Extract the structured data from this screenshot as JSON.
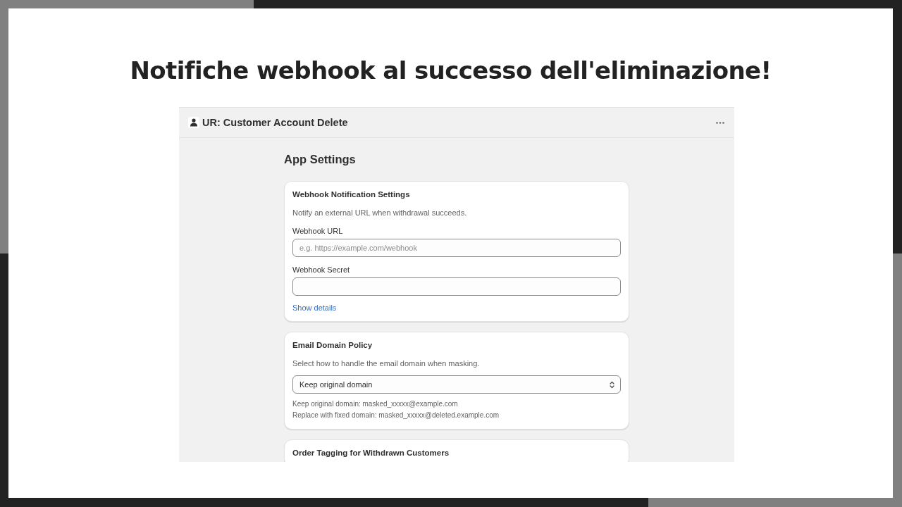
{
  "headline": "Notifiche webhook al successo dell'eliminazione!",
  "app": {
    "title": "UR: Customer Account Delete",
    "page_title": "App Settings",
    "cards": [
      {
        "title": "Webhook Notification Settings",
        "description": "Notify an external URL when withdrawal succeeds.",
        "fields": [
          {
            "kind": "text",
            "label": "Webhook URL",
            "placeholder": "e.g. https://example.com/webhook"
          },
          {
            "kind": "text",
            "label": "Webhook Secret"
          }
        ],
        "link": "Show details"
      },
      {
        "title": "Email Domain Policy",
        "description": "Select how to handle the email domain when masking.",
        "fields": [
          {
            "kind": "select",
            "value": "Keep original domain"
          }
        ],
        "notes": [
          "Keep original domain: masked_xxxxx@example.com",
          "Replace with fixed domain: masked_xxxxx@deleted.example.com"
        ]
      },
      {
        "title": "Order Tagging for Withdrawn Customers"
      }
    ]
  }
}
